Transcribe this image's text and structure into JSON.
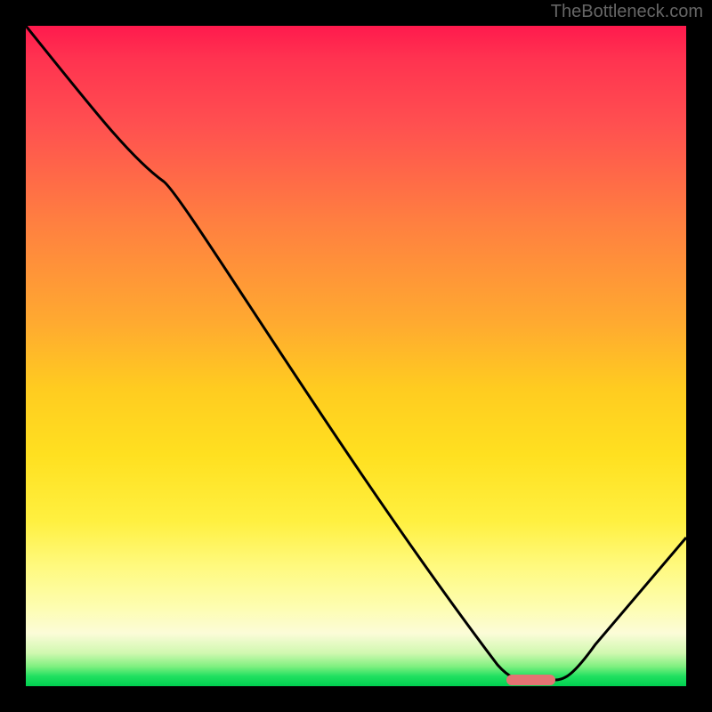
{
  "watermark": "TheBottleneck.com",
  "chart_data": {
    "type": "line",
    "title": "",
    "xlabel": "",
    "ylabel": "",
    "xlim": [
      0,
      100
    ],
    "ylim": [
      0,
      100
    ],
    "x": [
      0,
      20,
      73,
      80,
      100
    ],
    "values": [
      100,
      78,
      1,
      1,
      22
    ],
    "marker_x_range": [
      73,
      80
    ],
    "marker_y": 1,
    "background_gradient": {
      "top_color": "#ff1a4d",
      "mid_color": "#ffe020",
      "bottom_color": "#00d050"
    }
  }
}
